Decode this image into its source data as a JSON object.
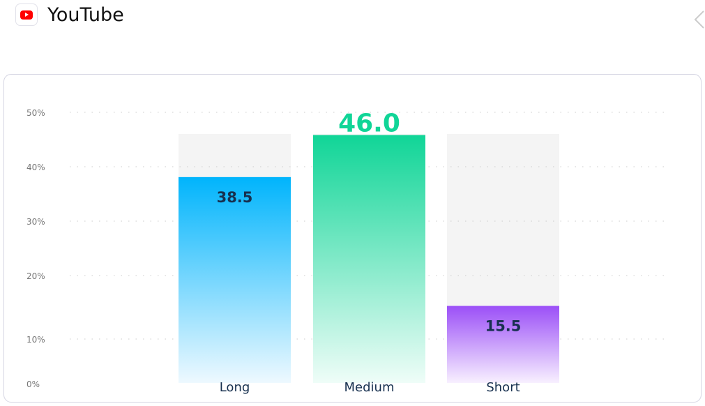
{
  "header": {
    "title": "YouTube",
    "logo_icon": "youtube-logo",
    "back_icon": "chevron-left-icon"
  },
  "chart_data": {
    "type": "bar",
    "categories": [
      "Long",
      "Medium",
      "Short"
    ],
    "values": [
      38.5,
      46.0,
      15.5
    ],
    "value_labels": [
      "38.5",
      "46.0",
      "15.5"
    ],
    "highlighted": "Medium",
    "ylim": [
      0,
      50
    ],
    "yticks": [
      "0%",
      "10%",
      "20%",
      "30%",
      "40%",
      "50%"
    ],
    "grid": true,
    "colors": {
      "Long": [
        "#00b4fc",
        "#eef9ff"
      ],
      "Medium": [
        "#10d597",
        "#effdf8"
      ],
      "Short": [
        "#9b4ff7",
        "#f8f0ff"
      ],
      "track": "#f4f4f4",
      "highlight_label": "#10d597",
      "label": "#17304f"
    }
  }
}
